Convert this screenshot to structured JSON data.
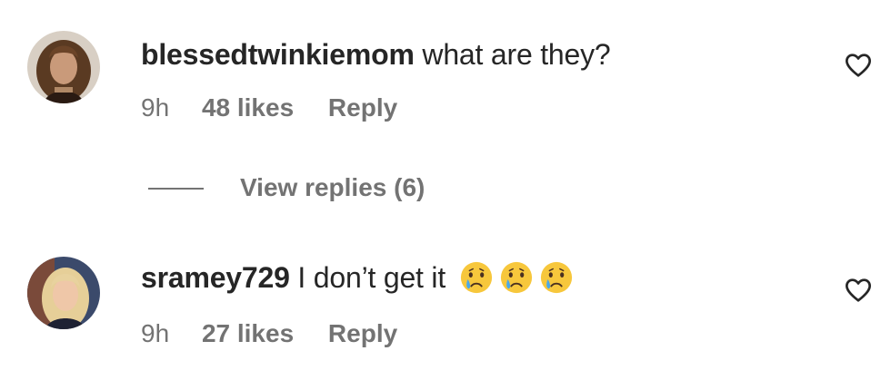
{
  "comments": [
    {
      "username": "blessedtwinkiemom",
      "text": "what are they?",
      "time": "9h",
      "likes": "48 likes",
      "reply_label": "Reply",
      "avatar_icon": "user-avatar-photo",
      "like_icon": "heart-outline-icon"
    },
    {
      "username": "sramey729",
      "text": "I don’t get it",
      "emojis": [
        "crying-face-emoji",
        "crying-face-emoji",
        "crying-face-emoji"
      ],
      "time": "9h",
      "likes": "27 likes",
      "reply_label": "Reply",
      "avatar_icon": "user-avatar-photo",
      "like_icon": "heart-outline-icon"
    }
  ],
  "view_replies": {
    "label": "View replies (6)"
  },
  "colors": {
    "primary_text": "#262626",
    "secondary_text": "#737373",
    "background": "#ffffff"
  }
}
